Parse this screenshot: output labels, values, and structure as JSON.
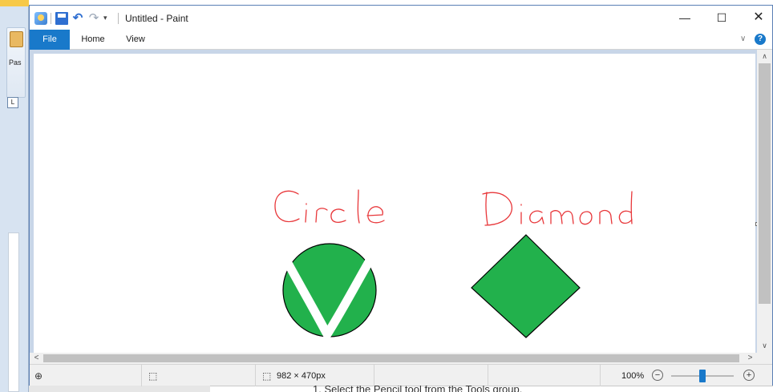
{
  "window": {
    "title": "Untitled - Paint",
    "minimize": "—",
    "maximize": "☐",
    "close": "✕"
  },
  "quick_access": {
    "save_icon": "save-icon",
    "undo_icon": "undo-icon",
    "redo_icon": "redo-icon",
    "dropdown": "▾"
  },
  "ribbon": {
    "tabs": [
      {
        "label": "File",
        "active": true
      },
      {
        "label": "Home",
        "active": false
      },
      {
        "label": "View",
        "active": false
      }
    ],
    "collapse_icon": "∨",
    "help_icon": "?"
  },
  "canvas": {
    "labels": [
      "Circle",
      "Diamond"
    ],
    "ink_color": "#e8373a",
    "shape_fill": "#22b14c",
    "stroke_color": "#000000"
  },
  "scrollbars": {
    "up": "∧",
    "down": "∨",
    "left": "<",
    "right": ">"
  },
  "statusbar": {
    "cursor_icon": "⊕",
    "selection_icon": "⬚",
    "size_icon": "⬚",
    "image_size": "982 × 470px",
    "zoom_level": "100%",
    "zoom_out": "−",
    "zoom_in": "+",
    "zoom_fraction": 0.5
  },
  "background": {
    "paste_label": "Pas",
    "ruler_label": "L",
    "doc_text": "1.   Select the Pencil tool from the Tools group."
  }
}
